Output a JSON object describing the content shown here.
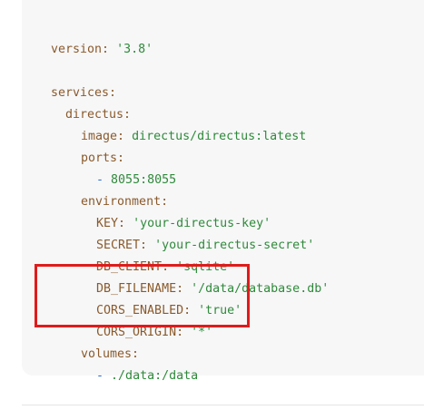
{
  "code": {
    "version_key": "version:",
    "version_val": "'3.8'",
    "services_key": "services:",
    "directus_key": "directus:",
    "image_key": "image:",
    "image_val": "directus/directus:latest",
    "ports_key": "ports:",
    "port_dash": "-",
    "port_val": "8055:8055",
    "environment_key": "environment:",
    "key_key": "KEY:",
    "key_val": "'your-directus-key'",
    "secret_key": "SECRET:",
    "secret_val": "'your-directus-secret'",
    "db_client_key": "DB_CLIENT:",
    "db_client_val": "'sqlite'",
    "db_filename_key": "DB_FILENAME:",
    "db_filename_val": "'/data/database.db'",
    "cors_enabled_key": "CORS_ENABLED:",
    "cors_enabled_val": "'true'",
    "cors_origin_key": "CORS_ORIGIN:",
    "cors_origin_val": "'*'",
    "volumes_key": "volumes:",
    "volume_dash": "-",
    "volume_val": "./data:/data"
  },
  "colors": {
    "highlight": "#e01b1b",
    "key": "#8a5a2b",
    "string": "#2f8a3a",
    "dash": "#2f6fd0",
    "background": "#f7f7f8"
  }
}
